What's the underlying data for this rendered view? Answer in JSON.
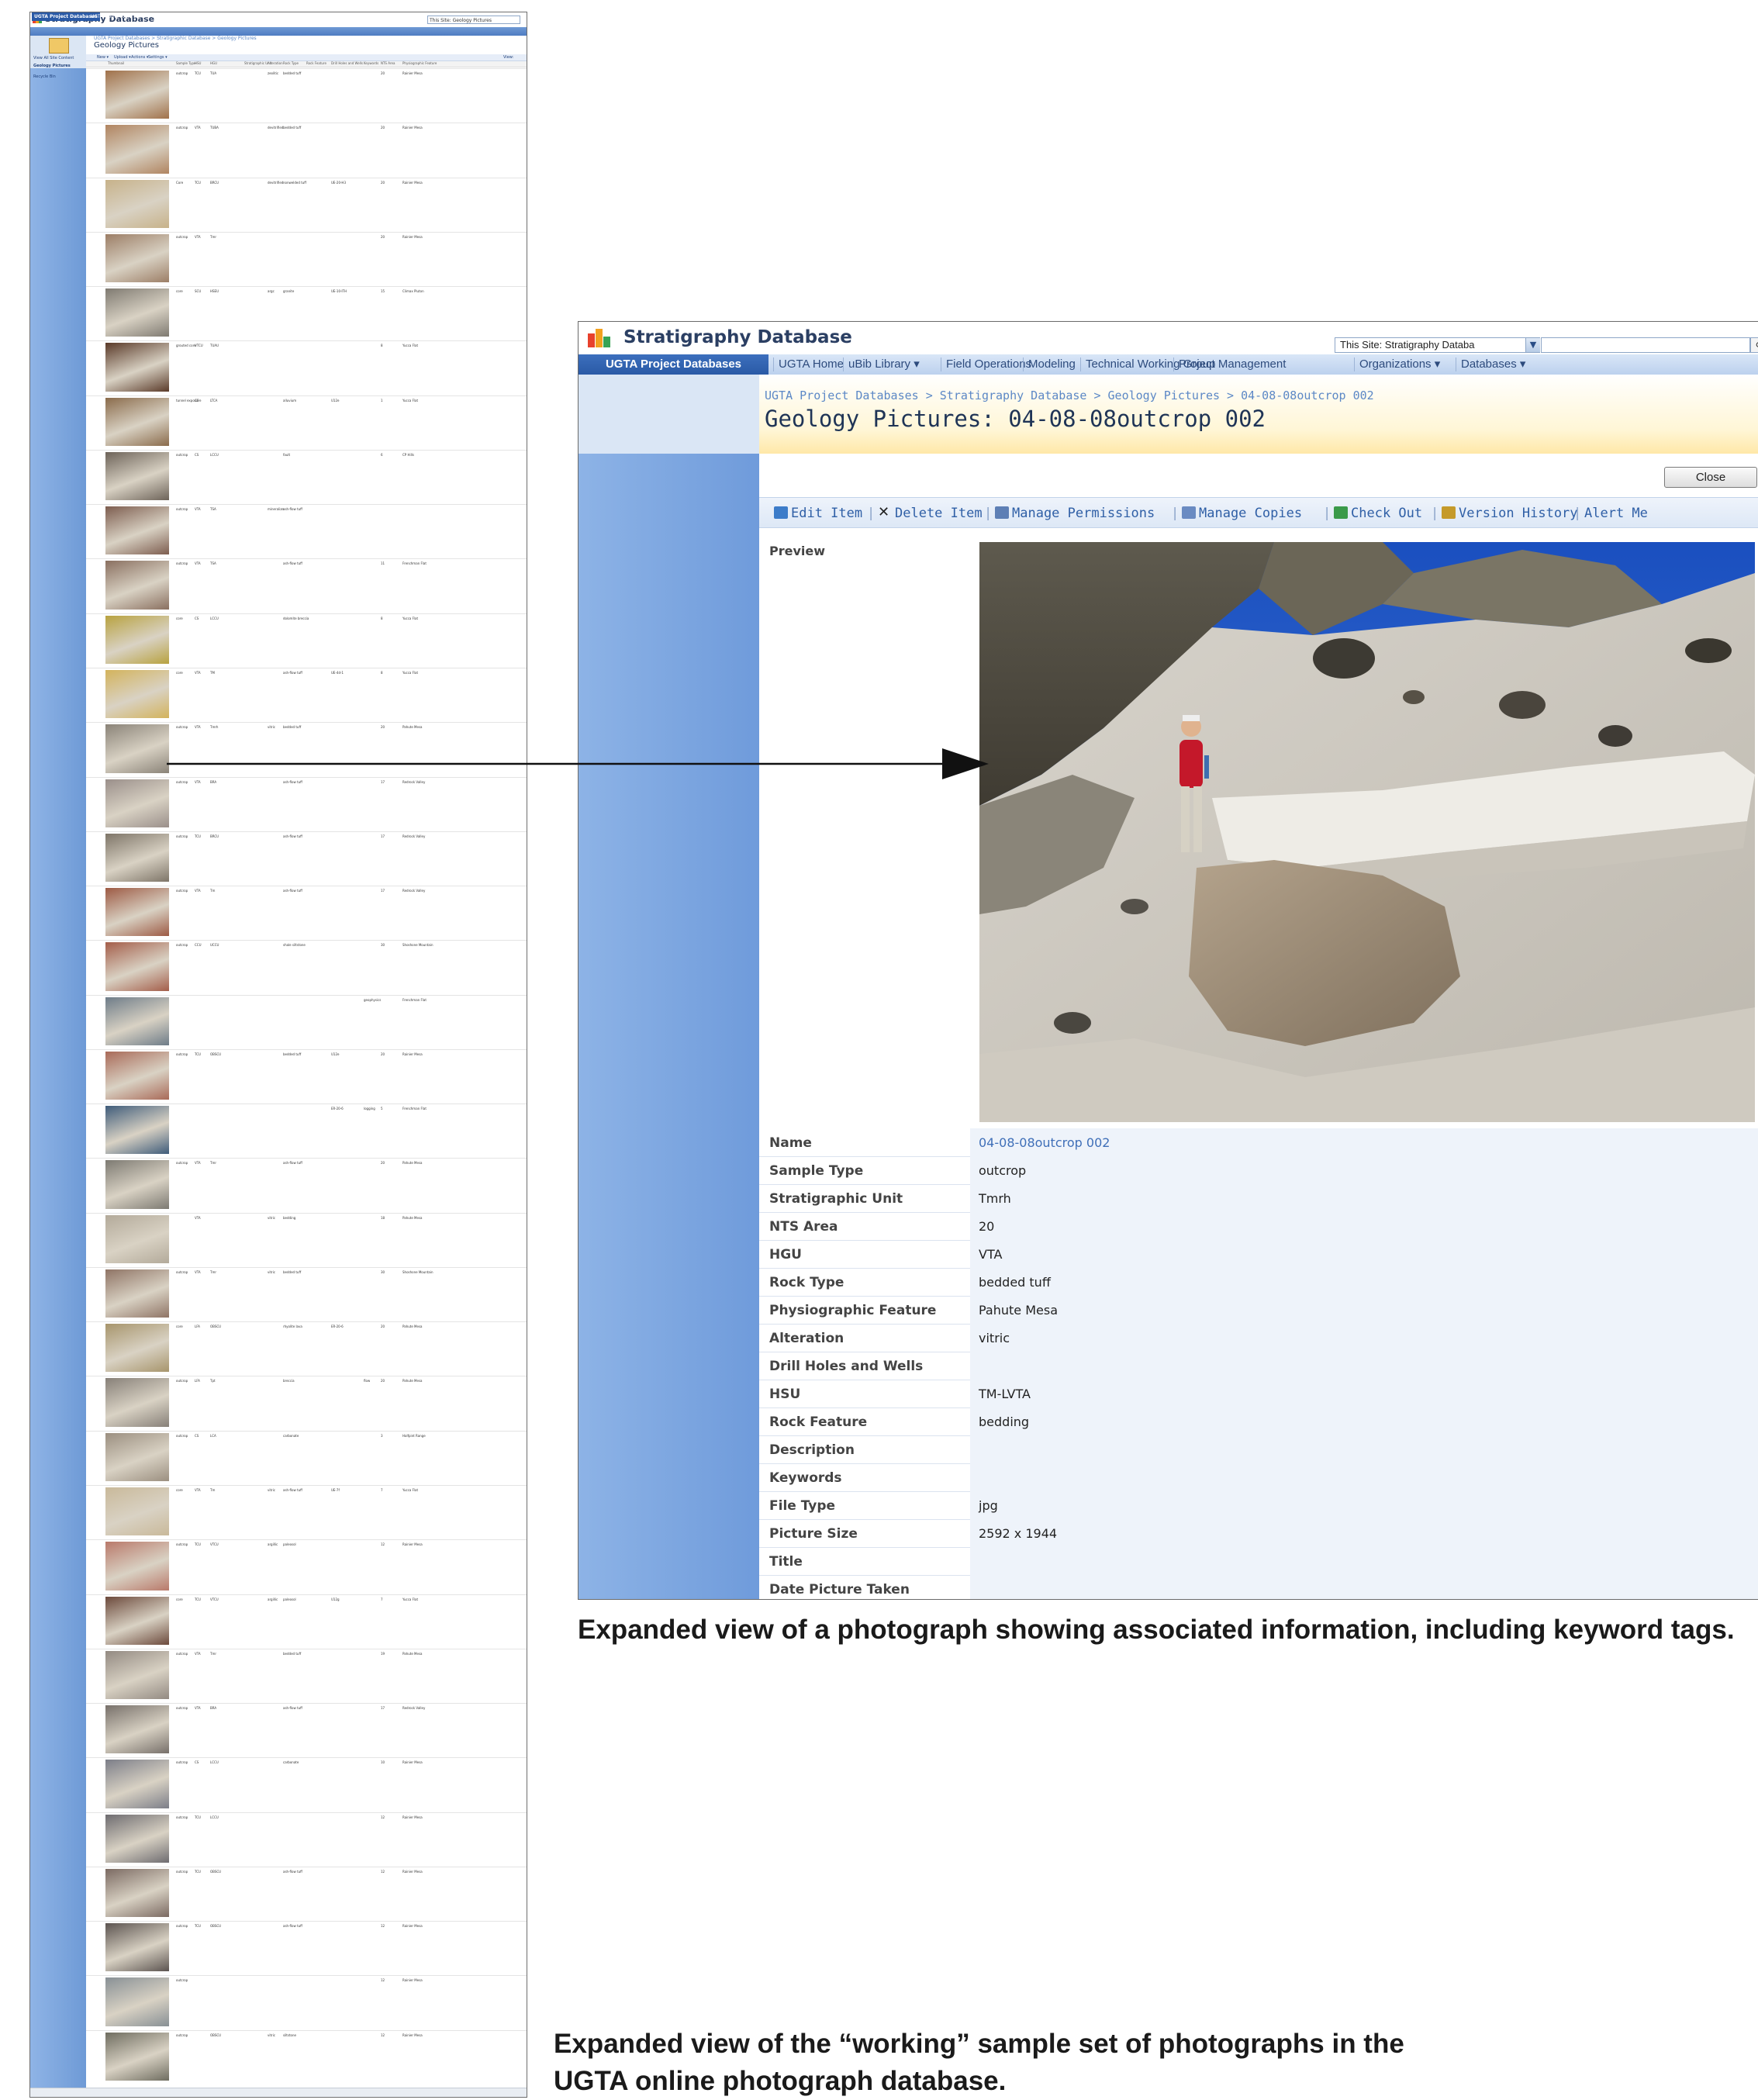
{
  "list_screenshot": {
    "site_title": "Stratigraphy Database",
    "search_scope": "This Site: Geology Pictures",
    "nav": [
      "UGTA Project Databases",
      "UGTA Home",
      "uBib Library ▾",
      "Field Operations",
      "Modeling",
      "Technical Working Group",
      "Project Management",
      "Organizations ▾",
      "Databases ▾"
    ],
    "side_links": [
      "View All Site Content",
      "Geology Pictures",
      "Recycle Bin"
    ],
    "breadcrumb": "UGTA Project Databases > Stratigraphic Database > Geology Pictures",
    "heading": "Geology Pictures",
    "toolbar": [
      "New ▾",
      "Upload ▾",
      "Actions ▾",
      "Settings ▾"
    ],
    "view_label": "View:",
    "columns": [
      "Thumbnail",
      "Sample Type",
      "HSU",
      "HGU",
      "Stratigraphic Unit",
      "Alteration",
      "Rock Type",
      "Rock Feature",
      "Drill Holes and Wells",
      "Keywords",
      "NTS Area",
      "Physiographic Feature"
    ],
    "rows": [
      {
        "type": "outcrop",
        "hsu": "TCU",
        "hgu": "TUA",
        "alt": "zeolitic",
        "rock": "bedded tuff",
        "area": "20",
        "feature": "Rainier Mesa",
        "color": "#a0714a"
      },
      {
        "type": "outcrop",
        "hsu": "VTA",
        "hgu": "TUBA",
        "alt": "devitrified",
        "rock": "bedded tuff",
        "area": "20",
        "feature": "Rainier Mesa",
        "color": "#b08460"
      },
      {
        "type": "Core",
        "hsu": "TCU",
        "hgu": "BRCU",
        "alt": "devitrified",
        "rock": "nonwelded tuff",
        "well": "UE-20-H3",
        "area": "20",
        "feature": "Rainier Mesa",
        "color": "#c7b28a"
      },
      {
        "type": "outcrop",
        "hsu": "VTA",
        "hgu": "Tmr",
        "area": "20",
        "feature": "Rainier Mesa",
        "color": "#9c7e66"
      },
      {
        "type": "core",
        "hsu": "SCU",
        "hgu": "HSEU",
        "alt": "argc",
        "rock": "granite",
        "well": "UE-10-ITH",
        "area": "15",
        "feature": "Climax Pluton",
        "color": "#7f7a71"
      },
      {
        "type": "grouted core",
        "hsu": "VTCU",
        "hgu": "TUAU",
        "rock": "",
        "area": "8",
        "feature": "Yucca Flat",
        "color": "#5a3a29"
      },
      {
        "type": "tunnel exposure",
        "hsu": "CS",
        "hgu": "LTCA",
        "rock": "alluvium",
        "well": "U12e",
        "area": "1",
        "feature": "Yucca Flat",
        "color": "#8a6b4b"
      },
      {
        "type": "outcrop",
        "hsu": "CS",
        "hgu": "LCCU",
        "rock": "fault",
        "area": "6",
        "feature": "CP Hills",
        "color": "#6d6359"
      },
      {
        "type": "outcrop",
        "hsu": "VTA",
        "hgu": "TSA",
        "alt": "mineralize",
        "rock": "ash-flow tuff",
        "area": "",
        "feature": "",
        "color": "#7d5d4f"
      },
      {
        "type": "outcrop",
        "hsu": "VTA",
        "hgu": "TSA",
        "rock": "ash-flow tuff",
        "area": "11",
        "feature": "Frenchman Flat",
        "color": "#8a7060"
      },
      {
        "type": "core",
        "hsu": "CS",
        "hgu": "LCCU",
        "rock": "dolomite breccia",
        "area": "8",
        "feature": "Yucca Flat",
        "color": "#b8a240"
      },
      {
        "type": "core",
        "hsu": "VTA",
        "hgu": "TM",
        "rock": "ash-flow tuff",
        "well": "UE-4d-1",
        "area": "8",
        "feature": "Yucca Flat",
        "color": "#d3b35c"
      },
      {
        "type": "outcrop",
        "hsu": "VTA",
        "hgu": "Tmrh",
        "alt": "vitric",
        "rock": "bedded tuff",
        "area": "20",
        "feature": "Pahute Mesa",
        "color": "#8a8378"
      },
      {
        "type": "outcrop",
        "hsu": "VTA",
        "hgu": "BRA",
        "rock": "ash-flow tuff",
        "area": "17",
        "feature": "Redrock Valley",
        "color": "#9a8f8a"
      },
      {
        "type": "outcrop",
        "hsu": "TCU",
        "hgu": "BRCU",
        "rock": "ash-flow tuff",
        "area": "17",
        "feature": "Redrock Valley",
        "color": "#7e7568"
      },
      {
        "type": "outcrop",
        "hsu": "VTA",
        "hgu": "Tm",
        "rock": "ash-flow tuff",
        "area": "17",
        "feature": "Redrock Valley",
        "color": "#9d5a44"
      },
      {
        "type": "outcrop",
        "hsu": "CCU",
        "hgu": "UCCU",
        "rock": "shale siltstone",
        "area": "30",
        "feature": "Shoshone Mountain",
        "color": "#a45e4a"
      },
      {
        "type": "",
        "keywords": "geophysics",
        "area": "",
        "feature": "Frenchman Flat",
        "color": "#6e7c88"
      },
      {
        "type": "outcrop",
        "hsu": "TCU",
        "hgu": "OBSCU",
        "rock": "bedded tuff",
        "well": "U12e",
        "area": "20",
        "feature": "Rainier Mesa",
        "color": "#a96a58"
      },
      {
        "type": "",
        "well": "ER-20-6",
        "keywords": "logging",
        "area": "5",
        "feature": "Frenchman Flat",
        "color": "#3f5c7a"
      },
      {
        "type": "outcrop",
        "hsu": "VTA",
        "hgu": "Tmr",
        "rock": "ash-flow tuff",
        "area": "20",
        "feature": "Pahute Mesa",
        "color": "#7d7a72"
      },
      {
        "type": "",
        "hsu": "VTA",
        "alt": "vitric",
        "rock": "bedding",
        "area": "18",
        "feature": "Pahute Mesa",
        "color": "#b3aa9a"
      },
      {
        "type": "outcrop",
        "hsu": "VTA",
        "hgu": "Tmr",
        "alt": "vitric",
        "rock": "bedded tuff",
        "area": "30",
        "feature": "Shoshone Mountain",
        "color": "#8f7465"
      },
      {
        "type": "core",
        "hsu": "LFA",
        "hgu": "OBSCU",
        "rock": "rhyolite lava",
        "well": "ER-20-6",
        "area": "20",
        "feature": "Pahute Mesa",
        "color": "#a7956c"
      },
      {
        "type": "outcrop",
        "hsu": "LFA",
        "hgu": "Tpt",
        "rock": "breccia",
        "keywords": "flow",
        "area": "20",
        "feature": "Pahute Mesa",
        "color": "#878078"
      },
      {
        "type": "outcrop",
        "hsu": "CS",
        "hgu": "LCA",
        "rock": "carbonate",
        "area": "3",
        "feature": "Halfpint Range",
        "color": "#9b8f80"
      },
      {
        "type": "core",
        "hsu": "VTA",
        "hgu": "Tm",
        "alt": "vitric",
        "rock": "ash-flow tuff",
        "well": "UE-7f",
        "area": "7",
        "feature": "Yucca Flat",
        "color": "#c9b99a"
      },
      {
        "type": "outcrop",
        "hsu": "TCU",
        "hgu": "VTCU",
        "alt": "argillic",
        "rock": "paleosol",
        "area": "12",
        "feature": "Rainier Mesa",
        "color": "#b9796a"
      },
      {
        "type": "core",
        "hsu": "TCU",
        "hgu": "VTCU",
        "alt": "argillic",
        "rock": "paleosol",
        "well": "U12g",
        "area": "7",
        "feature": "Yucca Flat",
        "color": "#6c4a3c"
      },
      {
        "type": "outcrop",
        "hsu": "VTA",
        "hgu": "Tmr",
        "rock": "bedded tuff",
        "area": "19",
        "feature": "Pahute Mesa",
        "color": "#938a82"
      },
      {
        "type": "outcrop",
        "hsu": "VTA",
        "hgu": "BRA",
        "rock": "ash-flow tuff",
        "area": "17",
        "feature": "Redrock Valley",
        "color": "#77706a"
      },
      {
        "type": "outcrop",
        "hsu": "CS",
        "hgu": "LCCU",
        "rock": "carbonate",
        "area": "10",
        "feature": "Rainier Mesa",
        "color": "#7c7e88"
      },
      {
        "type": "outcrop",
        "hsu": "TCU",
        "hgu": "LCCU",
        "area": "12",
        "feature": "Rainier Mesa",
        "color": "#6e6c70"
      },
      {
        "type": "outcrop",
        "hsu": "TCU",
        "hgu": "OBSCU",
        "rock": "ash-flow tuff",
        "area": "12",
        "feature": "Rainier Mesa",
        "color": "#7b6a62"
      },
      {
        "type": "outcrop",
        "hsu": "TCU",
        "hgu": "OBSCU",
        "rock": "ash-flow tuff",
        "area": "12",
        "feature": "Rainier Mesa",
        "color": "#5c5450"
      },
      {
        "type": "outcrop",
        "rock": "",
        "area": "12",
        "feature": "Rainier Mesa",
        "color": "#889095"
      },
      {
        "type": "outcrop",
        "hsu": "",
        "hgu": "OBSCU",
        "alt": "vitric",
        "rock": "siltstone",
        "area": "12",
        "feature": "Rainier Mesa",
        "color": "#6f6d60"
      }
    ]
  },
  "detail": {
    "site_title": "Stratigraphy Database",
    "search_scope": "This Site: Stratigraphy Databa",
    "search_icon": "magnifier-icon",
    "nav_active": "UGTA Project Databases",
    "nav": [
      "UGTA Home",
      "uBib Library ▾",
      "Field Operations",
      "Modeling",
      "Technical Working Group",
      "Project Management",
      "Organizations ▾",
      "Databases ▾"
    ],
    "breadcrumb": "UGTA Project Databases > Stratigraphy Database > Geology Pictures > 04-08-08outcrop 002",
    "heading": "Geology Pictures: 04-08-08outcrop 002",
    "close_label": "Close",
    "toolbar": [
      "Edit Item",
      "Delete Item",
      "Manage Permissions",
      "Manage Copies",
      "Check Out",
      "Version History",
      "Alert Me"
    ],
    "preview_label": "Preview",
    "fields": [
      {
        "label": "Name",
        "value": "04-08-08outcrop 002",
        "link": true
      },
      {
        "label": "Sample Type",
        "value": "outcrop"
      },
      {
        "label": "Stratigraphic Unit",
        "value": "Tmrh"
      },
      {
        "label": "NTS Area",
        "value": "20"
      },
      {
        "label": "HGU",
        "value": "VTA"
      },
      {
        "label": "Rock Type",
        "value": "bedded tuff"
      },
      {
        "label": "Physiographic Feature",
        "value": "Pahute Mesa"
      },
      {
        "label": "Alteration",
        "value": "vitric"
      },
      {
        "label": "Drill Holes and Wells",
        "value": ""
      },
      {
        "label": "HSU",
        "value": "TM-LVTA"
      },
      {
        "label": "Rock Feature",
        "value": "bedding"
      },
      {
        "label": "Description",
        "value": ""
      },
      {
        "label": "Keywords",
        "value": ""
      },
      {
        "label": "File Type",
        "value": "jpg"
      },
      {
        "label": "Picture Size",
        "value": "2592 x 1944"
      },
      {
        "label": "Title",
        "value": ""
      },
      {
        "label": "Date Picture Taken",
        "value": ""
      }
    ]
  },
  "captions": {
    "detail": "Expanded view of a photograph showing associated information, including keyword tags.",
    "list": "Expanded view of the “working” sample set of photographs in the UGTA online photograph database."
  },
  "colors": {
    "nav_blue": "#2a5aa6",
    "sidebar_blue": "#7aa4de",
    "link_blue": "#2f5fa6",
    "header_band": "#ffe8a8"
  }
}
